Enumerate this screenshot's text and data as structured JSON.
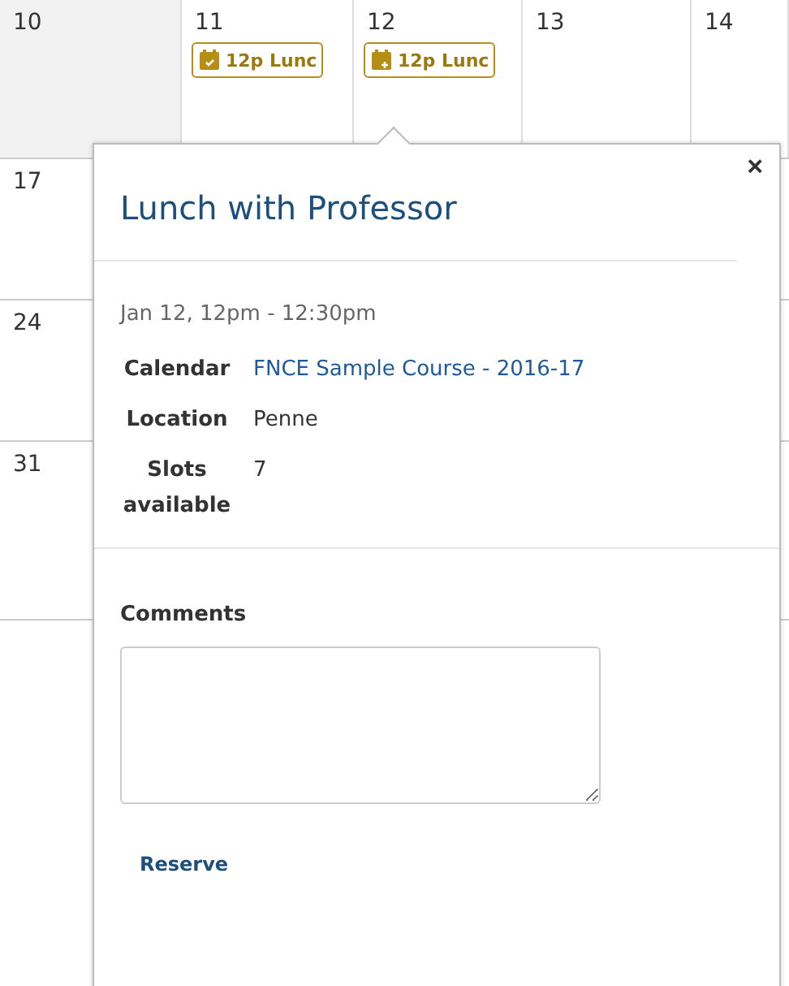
{
  "calendar": {
    "weeks": [
      {
        "days": [
          {
            "number": "10",
            "shaded": true
          },
          {
            "number": "11",
            "shaded": false,
            "events": [
              {
                "kind": "reserved",
                "label": "12p Lunc"
              }
            ]
          },
          {
            "number": "12",
            "shaded": false,
            "events": [
              {
                "kind": "available",
                "label": "12p Lunc"
              }
            ]
          },
          {
            "number": "13",
            "shaded": false
          },
          {
            "number": "14",
            "shaded": false
          }
        ]
      },
      {
        "days": [
          {
            "number": "17",
            "shaded": false
          }
        ]
      },
      {
        "days": [
          {
            "number": "24",
            "shaded": false
          }
        ]
      },
      {
        "days": [
          {
            "number": "31",
            "shaded": false
          }
        ]
      }
    ]
  },
  "popover": {
    "title": "Lunch with Professor",
    "close": "×",
    "when": "Jan 12, 12pm - 12:30pm",
    "details": [
      {
        "kind": "link",
        "label": "Calendar",
        "value": "FNCE Sample Course - 2016-17"
      },
      {
        "kind": "text",
        "label": "Location",
        "value": "Penne"
      },
      {
        "kind": "text",
        "label": "Slots available",
        "value": "7"
      }
    ],
    "comments_label": "Comments",
    "action": "Reserve"
  }
}
